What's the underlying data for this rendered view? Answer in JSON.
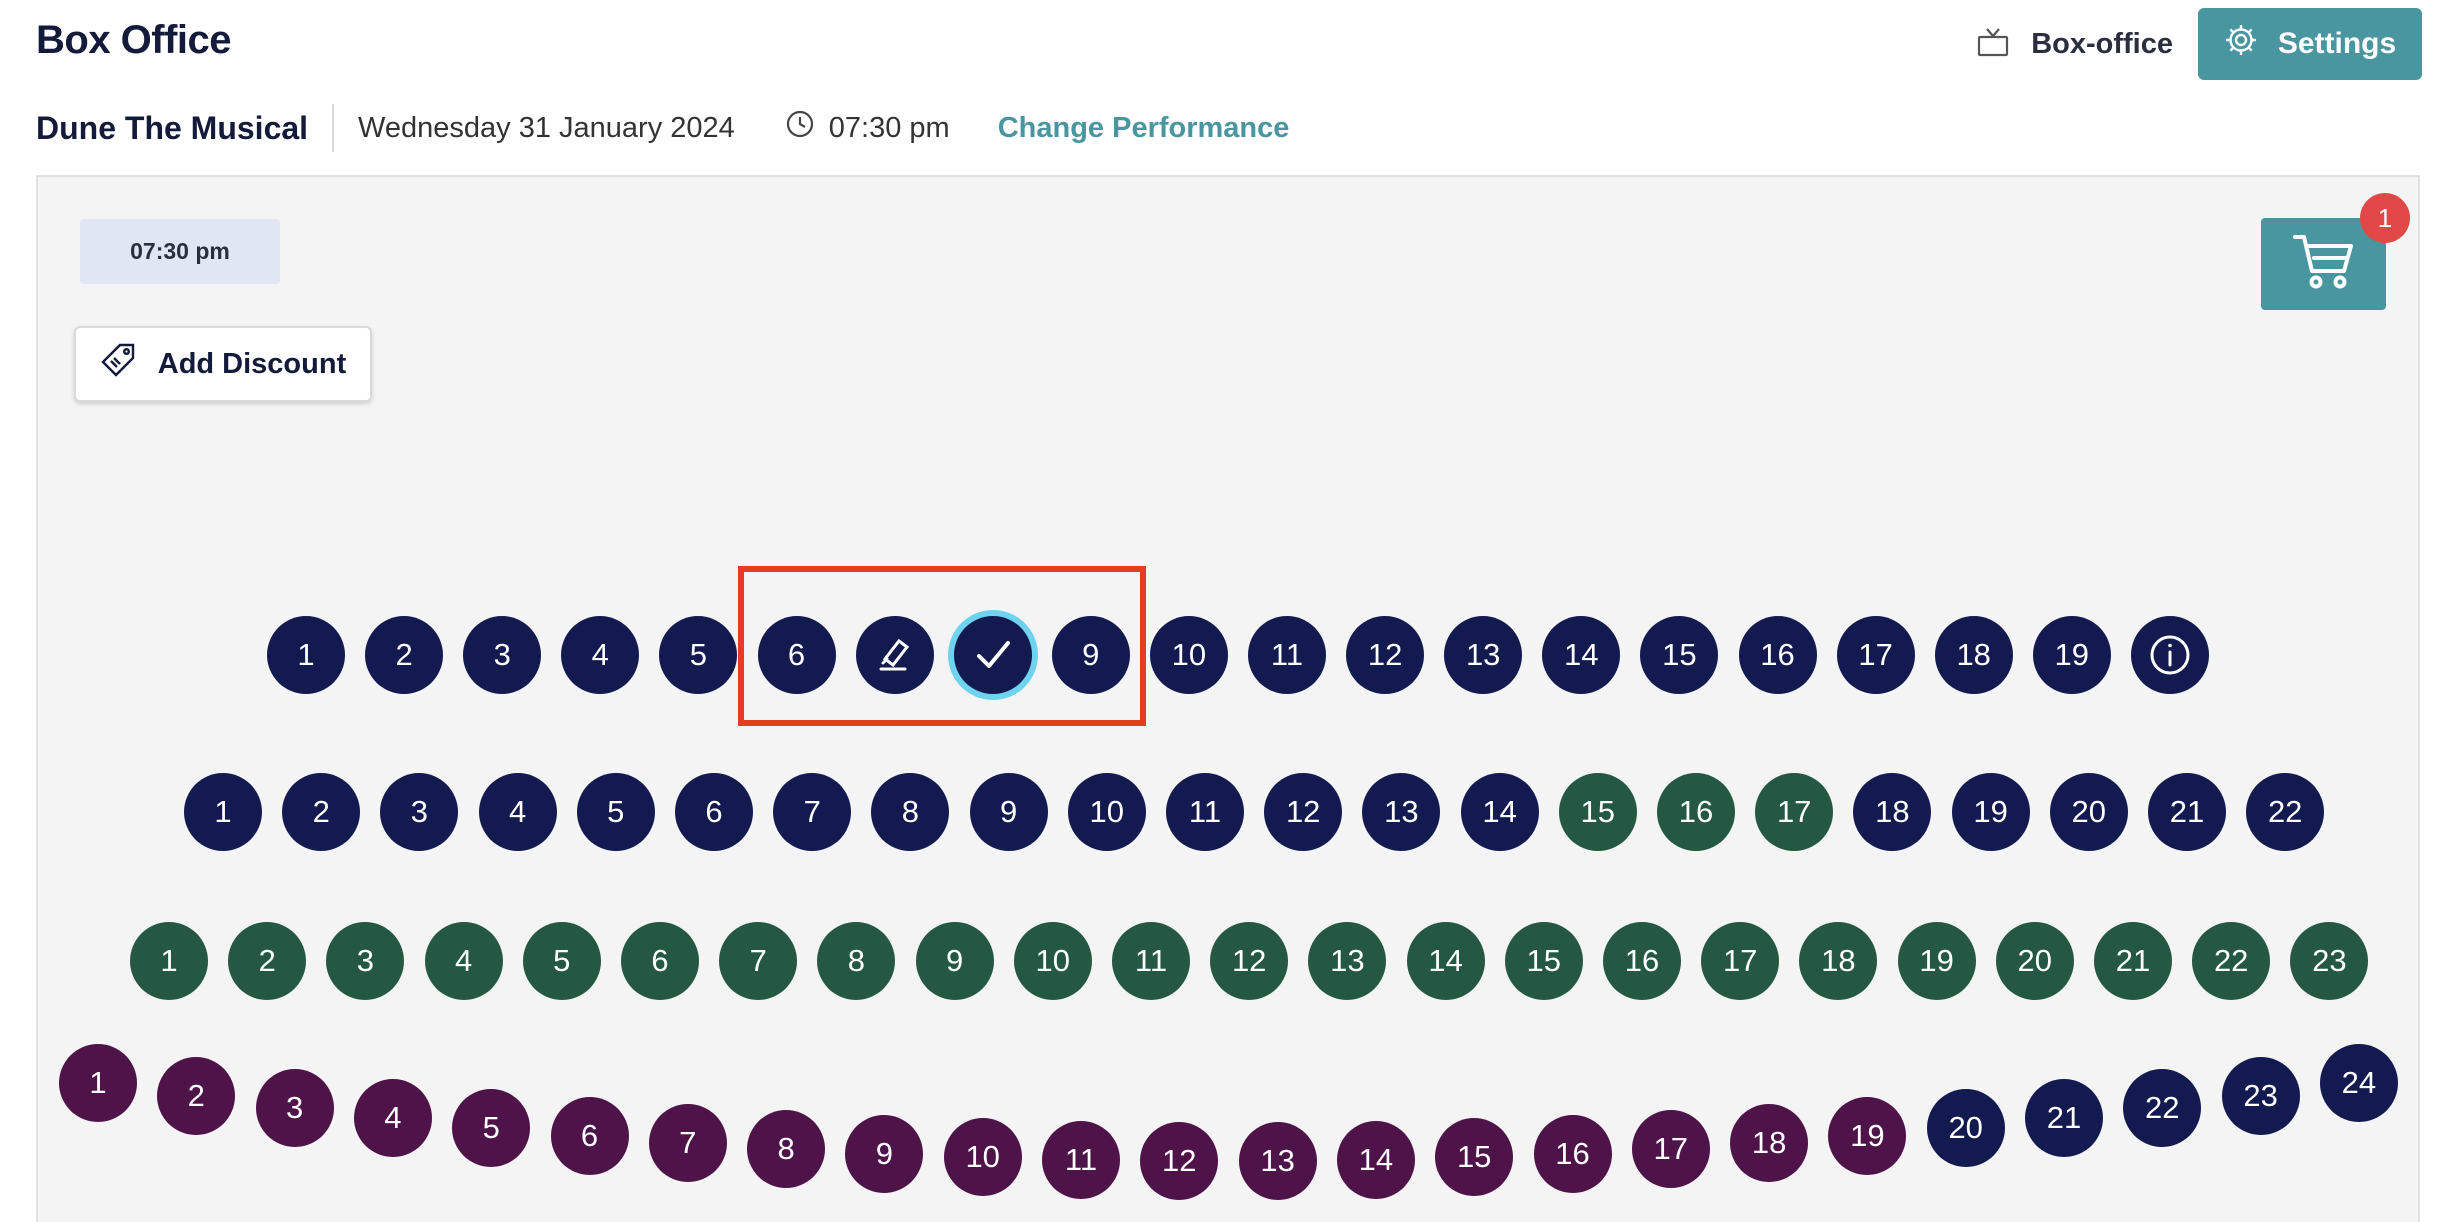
{
  "header": {
    "title": "Box Office",
    "box_office_label": "Box-office",
    "settings_label": "Settings"
  },
  "performance": {
    "show_name": "Dune The Musical",
    "date": "Wednesday 31 January 2024",
    "time": "07:30 pm",
    "change_label": "Change Performance"
  },
  "toolbar": {
    "time_chip": "07:30 pm",
    "add_discount_label": "Add Discount",
    "cart_count": "1"
  },
  "colors": {
    "accent": "#4a96a0",
    "seat_navy": "#131a4f",
    "seat_green": "#245843",
    "seat_purple": "#4e1349",
    "selected_ring": "#6ed3ef",
    "highlight": "#e63c23",
    "badge": "#e04848"
  },
  "seating": {
    "rows": [
      {
        "seats": [
          {
            "label": "1",
            "zone": "navy"
          },
          {
            "label": "2",
            "zone": "navy"
          },
          {
            "label": "3",
            "zone": "navy"
          },
          {
            "label": "4",
            "zone": "navy"
          },
          {
            "label": "5",
            "zone": "navy"
          },
          {
            "label": "6",
            "zone": "navy"
          },
          {
            "label": "",
            "zone": "navy",
            "icon": "wheelchair-icon"
          },
          {
            "label": "",
            "zone": "navy",
            "icon": "check-icon",
            "selected": true
          },
          {
            "label": "9",
            "zone": "navy"
          },
          {
            "label": "10",
            "zone": "navy"
          },
          {
            "label": "11",
            "zone": "navy"
          },
          {
            "label": "12",
            "zone": "navy"
          },
          {
            "label": "13",
            "zone": "navy"
          },
          {
            "label": "14",
            "zone": "navy"
          },
          {
            "label": "15",
            "zone": "navy"
          },
          {
            "label": "16",
            "zone": "navy"
          },
          {
            "label": "17",
            "zone": "navy"
          },
          {
            "label": "18",
            "zone": "navy"
          },
          {
            "label": "19",
            "zone": "navy"
          },
          {
            "label": "",
            "zone": "navy",
            "icon": "info-icon"
          }
        ]
      },
      {
        "seats": [
          {
            "label": "1",
            "zone": "navy"
          },
          {
            "label": "2",
            "zone": "navy"
          },
          {
            "label": "3",
            "zone": "navy"
          },
          {
            "label": "4",
            "zone": "navy"
          },
          {
            "label": "5",
            "zone": "navy"
          },
          {
            "label": "6",
            "zone": "navy"
          },
          {
            "label": "7",
            "zone": "navy"
          },
          {
            "label": "8",
            "zone": "navy"
          },
          {
            "label": "9",
            "zone": "navy"
          },
          {
            "label": "10",
            "zone": "navy"
          },
          {
            "label": "11",
            "zone": "navy"
          },
          {
            "label": "12",
            "zone": "navy"
          },
          {
            "label": "13",
            "zone": "navy"
          },
          {
            "label": "14",
            "zone": "navy"
          },
          {
            "label": "15",
            "zone": "green"
          },
          {
            "label": "16",
            "zone": "green"
          },
          {
            "label": "17",
            "zone": "green"
          },
          {
            "label": "18",
            "zone": "navy"
          },
          {
            "label": "19",
            "zone": "navy"
          },
          {
            "label": "20",
            "zone": "navy"
          },
          {
            "label": "21",
            "zone": "navy"
          },
          {
            "label": "22",
            "zone": "navy"
          }
        ]
      },
      {
        "seats": [
          {
            "label": "1",
            "zone": "green"
          },
          {
            "label": "2",
            "zone": "green"
          },
          {
            "label": "3",
            "zone": "green"
          },
          {
            "label": "4",
            "zone": "green"
          },
          {
            "label": "5",
            "zone": "green"
          },
          {
            "label": "6",
            "zone": "green"
          },
          {
            "label": "7",
            "zone": "green"
          },
          {
            "label": "8",
            "zone": "green"
          },
          {
            "label": "9",
            "zone": "green"
          },
          {
            "label": "10",
            "zone": "green"
          },
          {
            "label": "11",
            "zone": "green"
          },
          {
            "label": "12",
            "zone": "green"
          },
          {
            "label": "13",
            "zone": "green"
          },
          {
            "label": "14",
            "zone": "green"
          },
          {
            "label": "15",
            "zone": "green"
          },
          {
            "label": "16",
            "zone": "green"
          },
          {
            "label": "17",
            "zone": "green"
          },
          {
            "label": "18",
            "zone": "green"
          },
          {
            "label": "19",
            "zone": "green"
          },
          {
            "label": "20",
            "zone": "green"
          },
          {
            "label": "21",
            "zone": "green"
          },
          {
            "label": "22",
            "zone": "green"
          },
          {
            "label": "23",
            "zone": "green"
          }
        ]
      },
      {
        "seats": [
          {
            "label": "1",
            "zone": "purple"
          },
          {
            "label": "2",
            "zone": "purple"
          },
          {
            "label": "3",
            "zone": "purple"
          },
          {
            "label": "4",
            "zone": "purple"
          },
          {
            "label": "5",
            "zone": "purple"
          },
          {
            "label": "6",
            "zone": "purple"
          },
          {
            "label": "7",
            "zone": "purple"
          },
          {
            "label": "8",
            "zone": "purple"
          },
          {
            "label": "9",
            "zone": "purple"
          },
          {
            "label": "10",
            "zone": "purple"
          },
          {
            "label": "11",
            "zone": "purple"
          },
          {
            "label": "12",
            "zone": "purple"
          },
          {
            "label": "13",
            "zone": "purple"
          },
          {
            "label": "14",
            "zone": "purple"
          },
          {
            "label": "15",
            "zone": "purple"
          },
          {
            "label": "16",
            "zone": "purple"
          },
          {
            "label": "17",
            "zone": "purple"
          },
          {
            "label": "18",
            "zone": "purple"
          },
          {
            "label": "19",
            "zone": "purple"
          },
          {
            "label": "20",
            "zone": "navy"
          },
          {
            "label": "21",
            "zone": "navy"
          },
          {
            "label": "22",
            "zone": "navy"
          },
          {
            "label": "23",
            "zone": "navy"
          },
          {
            "label": "24",
            "zone": "navy"
          }
        ]
      }
    ]
  }
}
